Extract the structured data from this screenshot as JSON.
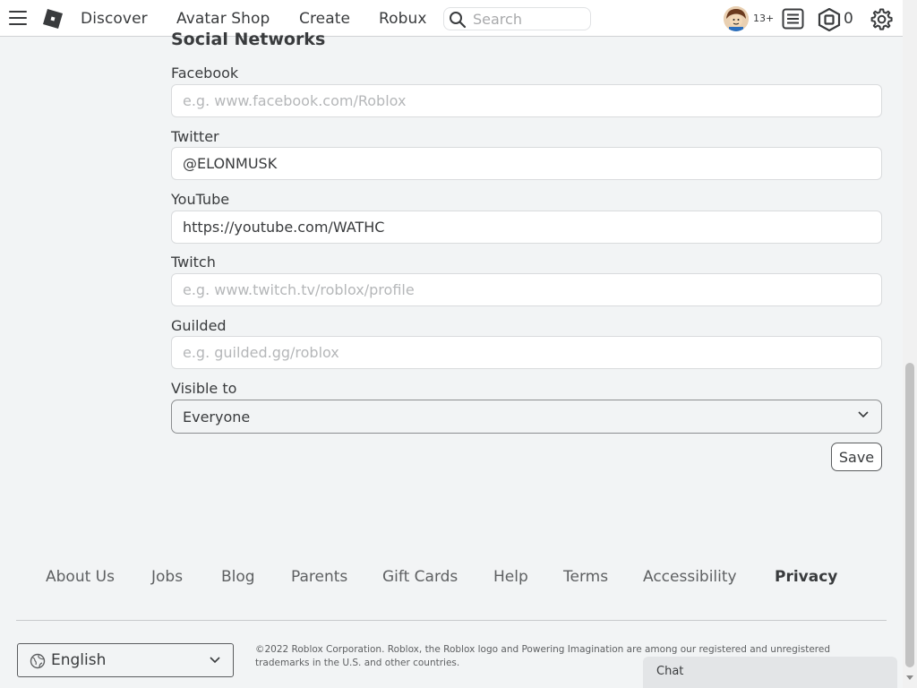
{
  "nav": {
    "links": [
      "Discover",
      "Avatar Shop",
      "Create",
      "Robux"
    ],
    "search_placeholder": "Search",
    "age_badge": "13+",
    "robux_balance": "0"
  },
  "form": {
    "section_title": "Social Networks",
    "facebook": {
      "label": "Facebook",
      "value": "",
      "placeholder": "e.g. www.facebook.com/Roblox"
    },
    "twitter": {
      "label": "Twitter",
      "value": "@ELONMUSK",
      "placeholder": ""
    },
    "youtube": {
      "label": "YouTube",
      "value": "https://youtube.com/WATHC",
      "placeholder": ""
    },
    "twitch": {
      "label": "Twitch",
      "value": "",
      "placeholder": "e.g. www.twitch.tv/roblox/profile"
    },
    "guilded": {
      "label": "Guilded",
      "value": "",
      "placeholder": "e.g. guilded.gg/roblox"
    },
    "visible_to": {
      "label": "Visible to",
      "value": "Everyone"
    },
    "save_label": "Save"
  },
  "footer": {
    "links": [
      "About Us",
      "Jobs",
      "Blog",
      "Parents",
      "Gift Cards",
      "Help",
      "Terms",
      "Accessibility",
      "Privacy"
    ],
    "language": "English",
    "copyright": "©2022 Roblox Corporation. Roblox, the Roblox logo and Powering Imagination are among our registered and unregistered trademarks in the U.S. and other countries."
  },
  "chat": {
    "label": "Chat"
  },
  "icons": {
    "menu": "hamburger-menu-icon",
    "logo": "roblox-logo-icon",
    "search": "search-icon",
    "notifications": "list-icon",
    "robux": "robux-icon",
    "settings": "gear-icon",
    "globe": "globe-icon",
    "chevron": "chevron-down-icon"
  },
  "colors": {
    "background": "#f2f4f5",
    "header": "#ffffff",
    "text": "#393b3d",
    "placeholder": "#b5b7b9"
  }
}
